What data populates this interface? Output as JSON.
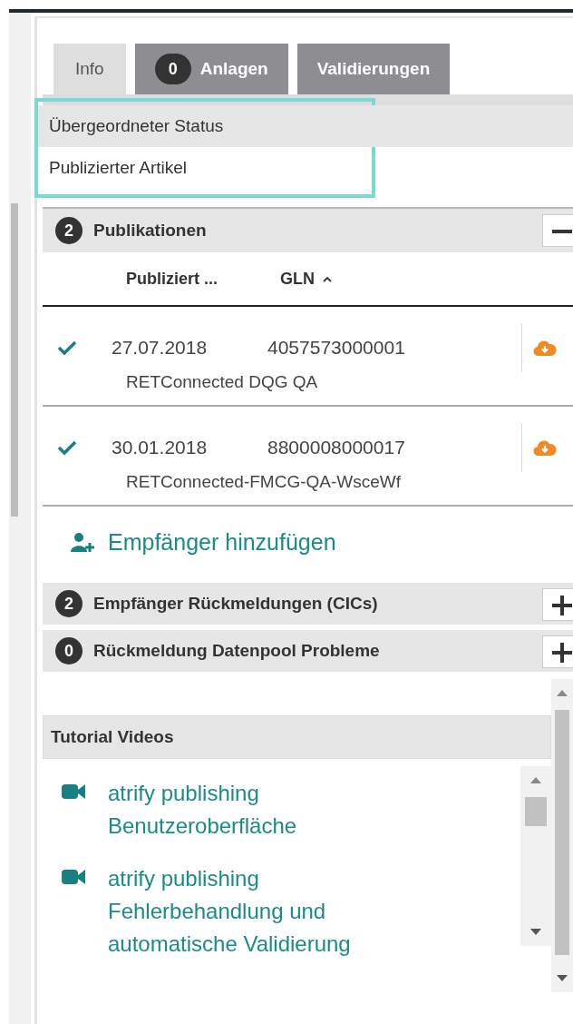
{
  "tabs": [
    {
      "label": "Info",
      "selected": true
    },
    {
      "label": "Anlagen",
      "badge": "0",
      "selected": false
    },
    {
      "label": "Validierungen",
      "selected": false
    }
  ],
  "status": {
    "items": [
      {
        "label": "Übergeordneter Status",
        "selected": true
      },
      {
        "label": "Publizierter Artikel",
        "selected": false
      }
    ]
  },
  "publications": {
    "count": "2",
    "title": "Publikationen",
    "expanded": true,
    "columns": [
      {
        "label": "Publiziert ...",
        "sorted": false
      },
      {
        "label": "GLN",
        "sorted": true
      }
    ],
    "rows": [
      {
        "published": true,
        "date": "27.07.2018",
        "gln": "4057573000001",
        "recipient": "RETConnected DQG QA"
      },
      {
        "published": true,
        "date": "30.01.2018",
        "gln": "8800008000017",
        "recipient": "RETConnected-FMCG-QA-WsceWf"
      }
    ],
    "add_link": "Empfänger hinzufügen"
  },
  "sections": [
    {
      "count": "2",
      "title": "Empfänger Rückmeldungen (CICs)",
      "expanded": false
    },
    {
      "count": "0",
      "title": "Rückmeldung Datenpool Probleme",
      "expanded": false
    }
  ],
  "tutorials": {
    "title": "Tutorial Videos",
    "videos": [
      "atrify publishing Benutzeroberfläche",
      "atrify publishing Fehlerbehandlung und automatische Validierung"
    ]
  }
}
